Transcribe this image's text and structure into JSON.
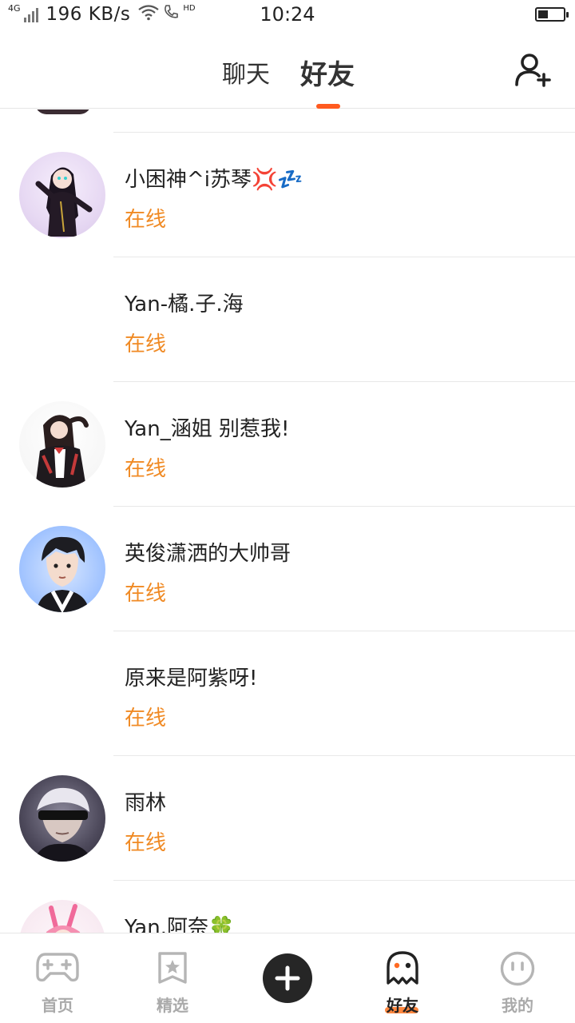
{
  "status_bar": {
    "network_type": "4G",
    "speed": "196 KB/s",
    "hd": "HD",
    "time": "10:24",
    "battery_percent": 40
  },
  "header": {
    "tabs": [
      {
        "label": "聊天",
        "active": false
      },
      {
        "label": "好友",
        "active": true
      }
    ],
    "add_friend_icon": "add-person-icon",
    "accent_color": "#ff5a1f"
  },
  "friends": [
    {
      "name": "小困神^i苏琴💢💤",
      "status": "在线",
      "has_avatar": true
    },
    {
      "name": "Yan-橘.子.海",
      "status": "在线",
      "has_avatar": false
    },
    {
      "name": "Yan_涵姐  别惹我!",
      "status": "在线",
      "has_avatar": true
    },
    {
      "name": "英俊潇洒的大帅哥",
      "status": "在线",
      "has_avatar": true
    },
    {
      "name": "原来是阿紫呀!",
      "status": "在线",
      "has_avatar": false
    },
    {
      "name": "雨林",
      "status": "在线",
      "has_avatar": true
    },
    {
      "name": "Yan.阿奈🍀",
      "status": "",
      "has_avatar": true
    }
  ],
  "status_color": "#f08a24",
  "bottom_nav": {
    "items": [
      {
        "label": "首页",
        "icon": "gamepad-icon",
        "active": false
      },
      {
        "label": "精选",
        "icon": "star-bookmark-icon",
        "active": false
      },
      {
        "label": "",
        "icon": "plus-icon",
        "active": false
      },
      {
        "label": "好友",
        "icon": "ghost-icon",
        "active": true
      },
      {
        "label": "我的",
        "icon": "face-icon",
        "active": false
      }
    ]
  }
}
